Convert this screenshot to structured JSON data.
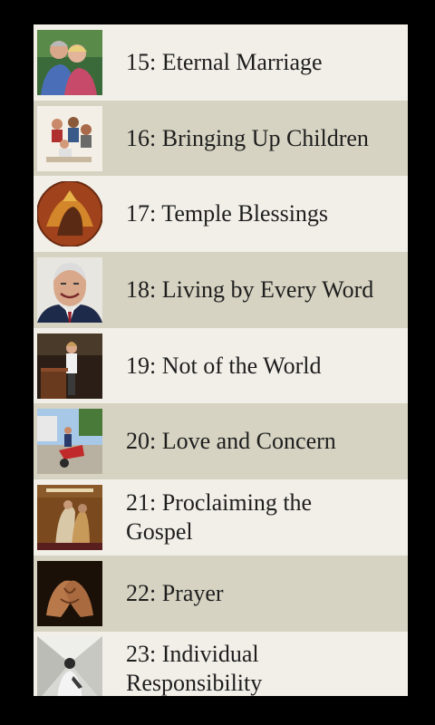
{
  "list": {
    "items": [
      {
        "label": "15: Eternal Marriage",
        "thumbnail": "elderly-couple-photo"
      },
      {
        "label": "16: Bringing Up Children",
        "thumbnail": "family-reading-photo"
      },
      {
        "label": "17: Temple Blessings",
        "thumbnail": "temple-painting"
      },
      {
        "label": "18: Living by Every Word",
        "thumbnail": "smiling-man-portrait"
      },
      {
        "label": "19: Not of the World",
        "thumbnail": "woman-at-pulpit-photo"
      },
      {
        "label": "20: Love and Concern",
        "thumbnail": "wheelbarrow-service-photo"
      },
      {
        "label": "21: Proclaiming the\nGospel",
        "thumbnail": "preach-my-gospel-cover"
      },
      {
        "label": "22: Prayer",
        "thumbnail": "folded-hands-photo"
      },
      {
        "label": "23: Individual\nResponsibility",
        "thumbnail": "man-at-crossroads-photo"
      }
    ]
  },
  "colors": {
    "row_light": "#f1efe8",
    "row_dark": "#d6d3c2",
    "text": "#1e1e1e",
    "frame": "#000000"
  }
}
